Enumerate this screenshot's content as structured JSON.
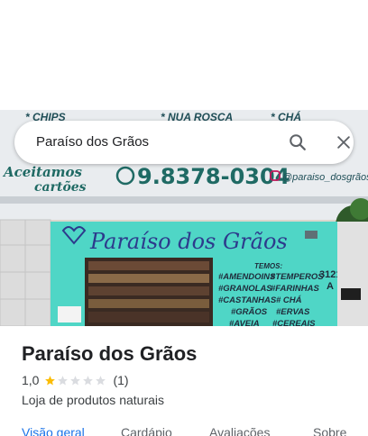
{
  "search": {
    "query": "Paraíso dos Grãos"
  },
  "photo": {
    "top_text_left": "* CHIPS",
    "top_text_mid": "* NUA ROSCA",
    "top_text_right": "* CHÁ",
    "accepts_line1": "Aceitamos",
    "accepts_line2": "cartões",
    "phone": "9.8378-0304",
    "instagram": "@paraiso_dosgrãos",
    "store_sign": "Paraíso dos Grãos",
    "temos_title": "TEMOS:",
    "temos_items": [
      "#AMENDOINS",
      "#TEMPEROS",
      "#GRANOLAS",
      "#FARINHAS",
      "#CASTANHAS",
      "# CHÁ",
      "#GRÃOS",
      "#ERVAS",
      "#AVEIA",
      "#CEREAIS"
    ],
    "house_number_1": "3121",
    "house_number_2": "A",
    "colors": {
      "facade": "#4fd6c6",
      "dark_text": "#1f4e57",
      "sign_text": "#2d3a8c"
    }
  },
  "place": {
    "name": "Paraíso dos Grãos",
    "rating": "1,0",
    "rating_value": 1,
    "rating_max": 5,
    "review_count": "(1)",
    "category": "Loja de produtos naturais"
  },
  "tabs": [
    {
      "label": "Visão geral",
      "active": true
    },
    {
      "label": "Cardápio",
      "active": false
    },
    {
      "label": "Avaliações",
      "active": false
    },
    {
      "label": "Sobre",
      "active": false
    }
  ],
  "colors": {
    "accent": "#1a73e8",
    "star_filled": "#fbbc04",
    "star_empty": "#dadce0"
  }
}
